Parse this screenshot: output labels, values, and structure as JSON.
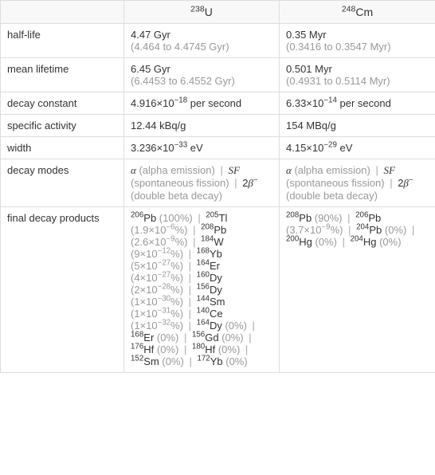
{
  "columns": {
    "c1": {
      "pre": "238",
      "sym": "U"
    },
    "c2": {
      "pre": "248",
      "sym": "Cm"
    }
  },
  "rows": {
    "half_life": {
      "label": "half-life",
      "c1": {
        "main": "4.47 Gyr",
        "sub": "(4.464 to 4.4745 Gyr)"
      },
      "c2": {
        "main": "0.35 Myr",
        "sub": "(0.3416 to 0.3547 Myr)"
      }
    },
    "mean_lifetime": {
      "label": "mean lifetime",
      "c1": {
        "main": "6.45 Gyr",
        "sub": "(6.4453 to 6.4552 Gyr)"
      },
      "c2": {
        "main": "0.501 Myr",
        "sub": "(0.4931 to 0.5114 Myr)"
      }
    },
    "decay_constant": {
      "label": "decay constant",
      "c1": {
        "coef": "4.916×10",
        "exp": "−18",
        "suffix": " per second"
      },
      "c2": {
        "coef": "6.33×10",
        "exp": "−14",
        "suffix": " per second"
      }
    },
    "specific_activity": {
      "label": "specific activity",
      "c1": "12.44 kBq/g",
      "c2": "154 MBq/g"
    },
    "width": {
      "label": "width",
      "c1": {
        "coef": "3.236×10",
        "exp": "−33",
        "suffix": " eV"
      },
      "c2": {
        "coef": "4.15×10",
        "exp": "−29",
        "suffix": " eV"
      }
    },
    "decay_modes": {
      "label": "decay modes",
      "c1": {
        "m1": {
          "sym": "α",
          "desc": " (alpha emission)"
        },
        "m2": {
          "sym": "SF",
          "desc": " (spontaneous fission)"
        },
        "m3": {
          "sym_pre": "2",
          "sym": "β",
          "sym_sup": "−",
          "desc": " (double beta decay)"
        }
      },
      "c2": {
        "m1": {
          "sym": "α",
          "desc": " (alpha emission)"
        },
        "m2": {
          "sym": "SF",
          "desc": " (spontaneous fission)"
        },
        "m3": {
          "sym_pre": "2",
          "sym": "β",
          "sym_sup": "−",
          "desc": " (double beta decay)"
        }
      }
    },
    "final_decay_products": {
      "label": "final decay products",
      "c1": [
        {
          "pre": "206",
          "sym": "Pb",
          "pct": "(100%)"
        },
        {
          "pre": "205",
          "sym": "Tl",
          "pct_coef": "(1.9×10",
          "pct_exp": "−6",
          "pct_suf": "%)"
        },
        {
          "pre": "208",
          "sym": "Pb",
          "pct_coef": "(2.6×10",
          "pct_exp": "−9",
          "pct_suf": "%)"
        },
        {
          "pre": "184",
          "sym": "W",
          "pct_coef": "(9×10",
          "pct_exp": "−12",
          "pct_suf": "%)"
        },
        {
          "pre": "168",
          "sym": "Yb",
          "pct_coef": "(5×10",
          "pct_exp": "−27",
          "pct_suf": "%)"
        },
        {
          "pre": "164",
          "sym": "Er",
          "pct_coef": "(4×10",
          "pct_exp": "−27",
          "pct_suf": "%)"
        },
        {
          "pre": "160",
          "sym": "Dy",
          "pct_coef": "(2×10",
          "pct_exp": "−28",
          "pct_suf": "%)"
        },
        {
          "pre": "156",
          "sym": "Dy",
          "pct_coef": "(1×10",
          "pct_exp": "−30",
          "pct_suf": "%)"
        },
        {
          "pre": "144",
          "sym": "Sm",
          "pct_coef": "(1×10",
          "pct_exp": "−31",
          "pct_suf": "%)"
        },
        {
          "pre": "140",
          "sym": "Ce",
          "pct_coef": "(1×10",
          "pct_exp": "−32",
          "pct_suf": "%)"
        },
        {
          "pre": "164",
          "sym": "Dy",
          "pct": "(0%)"
        },
        {
          "pre": "168",
          "sym": "Er",
          "pct": "(0%)"
        },
        {
          "pre": "156",
          "sym": "Gd",
          "pct": "(0%)"
        },
        {
          "pre": "176",
          "sym": "Hf",
          "pct": "(0%)"
        },
        {
          "pre": "180",
          "sym": "Hf",
          "pct": "(0%)"
        },
        {
          "pre": "152",
          "sym": "Sm",
          "pct": "(0%)"
        },
        {
          "pre": "172",
          "sym": "Yb",
          "pct": "(0%)"
        }
      ],
      "c2": [
        {
          "pre": "208",
          "sym": "Pb",
          "pct": "(90%)"
        },
        {
          "pre": "206",
          "sym": "Pb",
          "pct_coef": "(3.7×10",
          "pct_exp": "−9",
          "pct_suf": "%)"
        },
        {
          "pre": "204",
          "sym": "Pb",
          "pct": "(0%)"
        },
        {
          "pre": "200",
          "sym": "Hg",
          "pct": "(0%)"
        },
        {
          "pre": "204",
          "sym": "Hg",
          "pct": "(0%)"
        }
      ]
    }
  },
  "sep": "|"
}
